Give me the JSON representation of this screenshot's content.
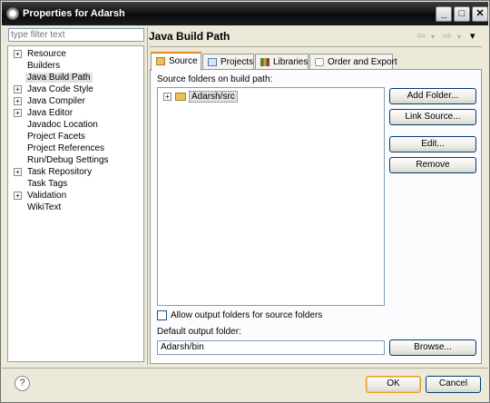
{
  "window": {
    "title": "Properties for Adarsh",
    "minimize": "_",
    "maximize": "□",
    "close": "✕"
  },
  "filter": {
    "placeholder": "type filter text"
  },
  "tree": [
    {
      "label": "Resource",
      "expandable": true
    },
    {
      "label": "Builders",
      "expandable": false
    },
    {
      "label": "Java Build Path",
      "expandable": false,
      "selected": true
    },
    {
      "label": "Java Code Style",
      "expandable": true
    },
    {
      "label": "Java Compiler",
      "expandable": true
    },
    {
      "label": "Java Editor",
      "expandable": true
    },
    {
      "label": "Javadoc Location",
      "expandable": false
    },
    {
      "label": "Project Facets",
      "expandable": false
    },
    {
      "label": "Project References",
      "expandable": false
    },
    {
      "label": "Run/Debug Settings",
      "expandable": false
    },
    {
      "label": "Task Repository",
      "expandable": true
    },
    {
      "label": "Task Tags",
      "expandable": false
    },
    {
      "label": "Validation",
      "expandable": true
    },
    {
      "label": "WikiText",
      "expandable": false
    }
  ],
  "page": {
    "title": "Java Build Path",
    "back": "⇦",
    "forward": "⇨",
    "menu": "▾"
  },
  "tabs": [
    {
      "label": "Source",
      "active": true
    },
    {
      "label": "Projects",
      "active": false
    },
    {
      "label": "Libraries",
      "active": false
    },
    {
      "label": "Order and Export",
      "active": false
    }
  ],
  "source": {
    "folders_label": "Source folders on build path:",
    "folders": [
      "Adarsh/src"
    ],
    "allow_output_label": "Allow output folders for source folders",
    "allow_output_checked": false,
    "default_output_label": "Default output folder:",
    "default_output_value": "Adarsh/bin"
  },
  "buttons": {
    "add_folder": "Add Folder...",
    "link_source": "Link Source...",
    "edit": "Edit...",
    "remove": "Remove",
    "browse": "Browse...",
    "ok": "OK",
    "cancel": "Cancel"
  },
  "help_icon": "?"
}
